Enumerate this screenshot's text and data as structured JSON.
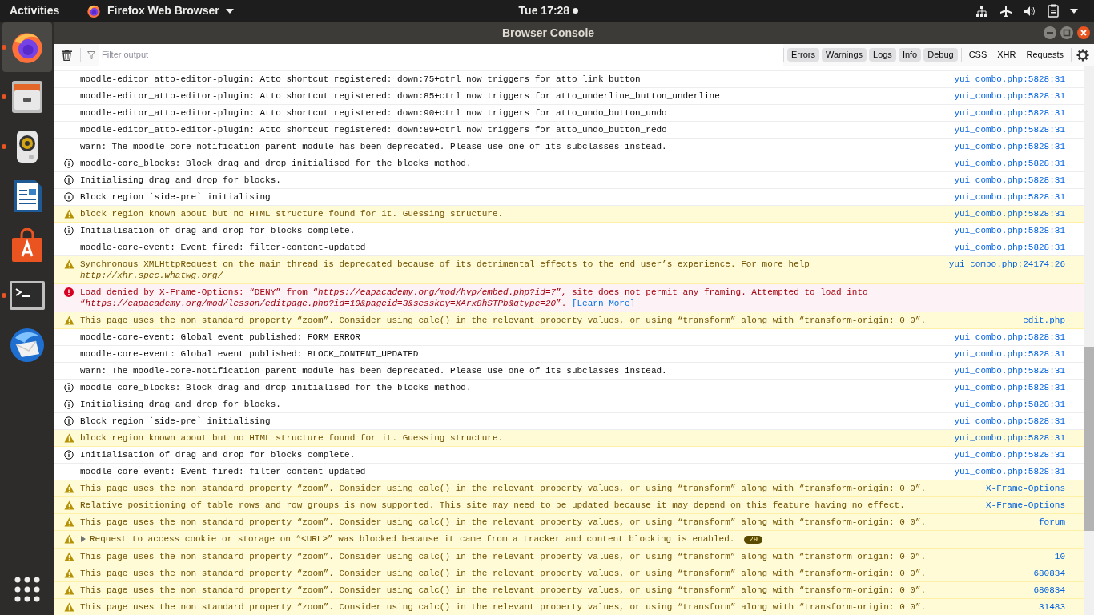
{
  "top_bar": {
    "activities": "Activities",
    "app_menu": "Firefox Web Browser",
    "clock": "Tue 17:28"
  },
  "dock": [
    {
      "kind": "firefox",
      "running": true,
      "selected": true
    },
    {
      "kind": "files",
      "running": true,
      "selected": false
    },
    {
      "kind": "speaker",
      "running": true,
      "selected": false
    },
    {
      "kind": "document",
      "running": false,
      "selected": false
    },
    {
      "kind": "store",
      "running": false,
      "selected": false
    },
    {
      "kind": "terminal",
      "running": true,
      "selected": false
    },
    {
      "kind": "mail",
      "running": false,
      "selected": false
    }
  ],
  "window": {
    "title": "Browser Console"
  },
  "toolbar": {
    "filter_placeholder": "Filter output",
    "levels": [
      {
        "label": "Errors",
        "selected": true
      },
      {
        "label": "Warnings",
        "selected": true
      },
      {
        "label": "Logs",
        "selected": true
      },
      {
        "label": "Info",
        "selected": true
      },
      {
        "label": "Debug",
        "selected": true
      }
    ],
    "requests": [
      {
        "label": "CSS",
        "selected": false
      },
      {
        "label": "XHR",
        "selected": false
      },
      {
        "label": "Requests",
        "selected": false
      }
    ]
  },
  "messages": [
    {
      "kind": "log",
      "text": "moodle-editor_atto-editor-plugin: Atto shortcut registered: down:75+ctrl now triggers for atto_link_button",
      "location": "yui_combo.php:5828:31"
    },
    {
      "kind": "log",
      "text": "moodle-editor_atto-editor-plugin: Atto shortcut registered: down:85+ctrl now triggers for atto_underline_button_underline",
      "location": "yui_combo.php:5828:31"
    },
    {
      "kind": "log",
      "text": "moodle-editor_atto-editor-plugin: Atto shortcut registered: down:90+ctrl now triggers for atto_undo_button_undo",
      "location": "yui_combo.php:5828:31"
    },
    {
      "kind": "log",
      "text": "moodle-editor_atto-editor-plugin: Atto shortcut registered: down:89+ctrl now triggers for atto_undo_button_redo",
      "location": "yui_combo.php:5828:31"
    },
    {
      "kind": "log",
      "text": "warn: The moodle-core-notification parent module has been deprecated. Please use one of its subclasses instead.",
      "location": "yui_combo.php:5828:31"
    },
    {
      "kind": "info",
      "text": "moodle-core_blocks: Block drag and drop initialised for the blocks method.",
      "location": "yui_combo.php:5828:31"
    },
    {
      "kind": "info",
      "text": "Initialising drag and drop for blocks.",
      "location": "yui_combo.php:5828:31"
    },
    {
      "kind": "info",
      "text": "Block region `side-pre` initialising",
      "location": "yui_combo.php:5828:31"
    },
    {
      "kind": "warn",
      "text": "block region known about but no HTML structure found for it. Guessing structure.",
      "location": "yui_combo.php:5828:31"
    },
    {
      "kind": "info",
      "text": "Initialisation of drag and drop for blocks complete.",
      "location": "yui_combo.php:5828:31"
    },
    {
      "kind": "log",
      "text": "moodle-core-event: Event fired: filter-content-updated",
      "location": "yui_combo.php:5828:31"
    },
    {
      "kind": "warn",
      "text": "Synchronous XMLHttpRequest on the main thread is deprecated because of its detrimental effects to the end user’s experience. For more help *http://xhr.spec.whatwg.org/*",
      "location": "yui_combo.php:24174:26"
    },
    {
      "kind": "error",
      "text": "Load denied by X-Frame-Options: “DENY” from “*https://eapacademy.org/mod/hvp/embed.php?id=7*”, site does not permit any framing. Attempted to load into “*https://eapacademy.org/mod/lesson/editpage.php?id=10&pageid=3&sesskey=XArx8hSTPb&qtype=20*”.",
      "link": "[Learn More]"
    },
    {
      "kind": "warn",
      "text": "This page uses the non standard property “zoom”. Consider using calc() in the relevant property values, or using “transform” along with “transform-origin: 0 0”.",
      "location": "edit.php"
    },
    {
      "kind": "log",
      "text": "moodle-core-event: Global event published: FORM_ERROR",
      "location": "yui_combo.php:5828:31"
    },
    {
      "kind": "log",
      "text": "moodle-core-event: Global event published: BLOCK_CONTENT_UPDATED",
      "location": "yui_combo.php:5828:31"
    },
    {
      "kind": "log",
      "text": "warn: The moodle-core-notification parent module has been deprecated. Please use one of its subclasses instead.",
      "location": "yui_combo.php:5828:31"
    },
    {
      "kind": "info",
      "text": "moodle-core_blocks: Block drag and drop initialised for the blocks method.",
      "location": "yui_combo.php:5828:31"
    },
    {
      "kind": "info",
      "text": "Initialising drag and drop for blocks.",
      "location": "yui_combo.php:5828:31"
    },
    {
      "kind": "info",
      "text": "Block region `side-pre` initialising",
      "location": "yui_combo.php:5828:31"
    },
    {
      "kind": "warn",
      "text": "block region known about but no HTML structure found for it. Guessing structure.",
      "location": "yui_combo.php:5828:31"
    },
    {
      "kind": "info",
      "text": "Initialisation of drag and drop for blocks complete.",
      "location": "yui_combo.php:5828:31"
    },
    {
      "kind": "log",
      "text": "moodle-core-event: Event fired: filter-content-updated",
      "location": "yui_combo.php:5828:31"
    },
    {
      "kind": "warn",
      "text": "This page uses the non standard property “zoom”. Consider using calc() in the relevant property values, or using “transform” along with “transform-origin: 0 0”.",
      "location": "X-Frame-Options"
    },
    {
      "kind": "warn",
      "text": "Relative positioning of table rows and row groups is now supported. This site may need to be updated because it may depend on this feature having no effect.",
      "location": "X-Frame-Options"
    },
    {
      "kind": "warn",
      "text": "This page uses the non standard property “zoom”. Consider using calc() in the relevant property values, or using “transform” along with “transform-origin: 0 0”.",
      "location": "forum"
    },
    {
      "kind": "warn",
      "text": "Request to access cookie or storage on “<URL>” was blocked because it came from a tracker and content blocking is enabled.",
      "expanded": false,
      "count": "29"
    },
    {
      "kind": "warn",
      "text": "This page uses the non standard property “zoom”. Consider using calc() in the relevant property values, or using “transform” along with “transform-origin: 0 0”.",
      "location": "10"
    },
    {
      "kind": "warn",
      "text": "This page uses the non standard property “zoom”. Consider using calc() in the relevant property values, or using “transform” along with “transform-origin: 0 0”.",
      "location": "680834"
    },
    {
      "kind": "warn",
      "text": "This page uses the non standard property “zoom”. Consider using calc() in the relevant property values, or using “transform” along with “transform-origin: 0 0”.",
      "location": "680834"
    },
    {
      "kind": "warn",
      "text": "This page uses the non standard property “zoom”. Consider using calc() in the relevant property values, or using “transform” along with “transform-origin: 0 0”.",
      "location": "31483"
    }
  ]
}
